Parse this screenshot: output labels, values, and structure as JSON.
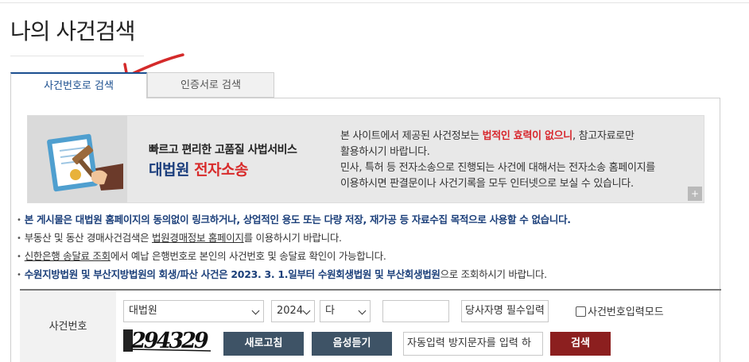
{
  "page": {
    "title": "나의 사건검색"
  },
  "tabs": [
    {
      "label": "사건번호로 검색",
      "active": true
    },
    {
      "label": "인증서로 검색",
      "active": false
    }
  ],
  "banner": {
    "tagline": "빠르고 편리한 고품질 사법서비스",
    "brand_part1": "대법원",
    "brand_part2": "전자소송",
    "desc_line1_pre": "본 사이트에서 제공된 사건정보는 ",
    "desc_line1_warn": "법적인 효력이 없으니",
    "desc_line1_post": ", 참고자료로만",
    "desc_line2": "활용하시기 바랍니다.",
    "desc_line3": "민사, 특허 등 전자소송으로 진행되는 사건에 대해서는 전자소송 홈페이지를",
    "desc_line4": "이용하시면 판결문이나 사건기록을 모두 인터넷으로 보실 수 있습니다.",
    "more_button": "+"
  },
  "notices": {
    "n1": "본 게시물은 대법원 홈페이지의 동의없이 링크하거나, 상업적인 용도 또는 다량 저장, 재가공 등 자료수집 목적으로 사용할 수 없습니다.",
    "n2_pre": "부동산 및 동산 경매사건검색은 ",
    "n2_link": "법원경매정보 홈페이지",
    "n2_post": "를 이용하시기 바랍니다.",
    "n3_link": "신한은행 송달료 조회",
    "n3_post": "에서 예납 은행번호로 본인의 사건번호 및 송달료 확인이 가능합니다.",
    "n4_strong": "수원지방법원 및 부산지방법원의 회생/파산 사건은 2023. 3. 1.일부터 수원회생법원 및 부산회생법원",
    "n4_post": "으로 조회하시기 바랍니다."
  },
  "search": {
    "row_label": "사건번호",
    "court_select": "대법원",
    "year_select": "2024",
    "type_select": "다",
    "case_number_value": "",
    "party_name_placeholder": "당사자명 필수입력",
    "case_input_mode_label": "사건번호입력모드",
    "captcha_text": "294329",
    "refresh_button": "새로고침",
    "audio_button": "음성듣기",
    "captcha_input_placeholder": "자동입력 방지문자를 입력 하",
    "search_button": "검색"
  },
  "colors": {
    "accent_blue": "#1b4f8f",
    "warning_red": "#d8262c",
    "search_button_bg": "#8c1f1f",
    "secondary_button_bg": "#3e5366"
  }
}
